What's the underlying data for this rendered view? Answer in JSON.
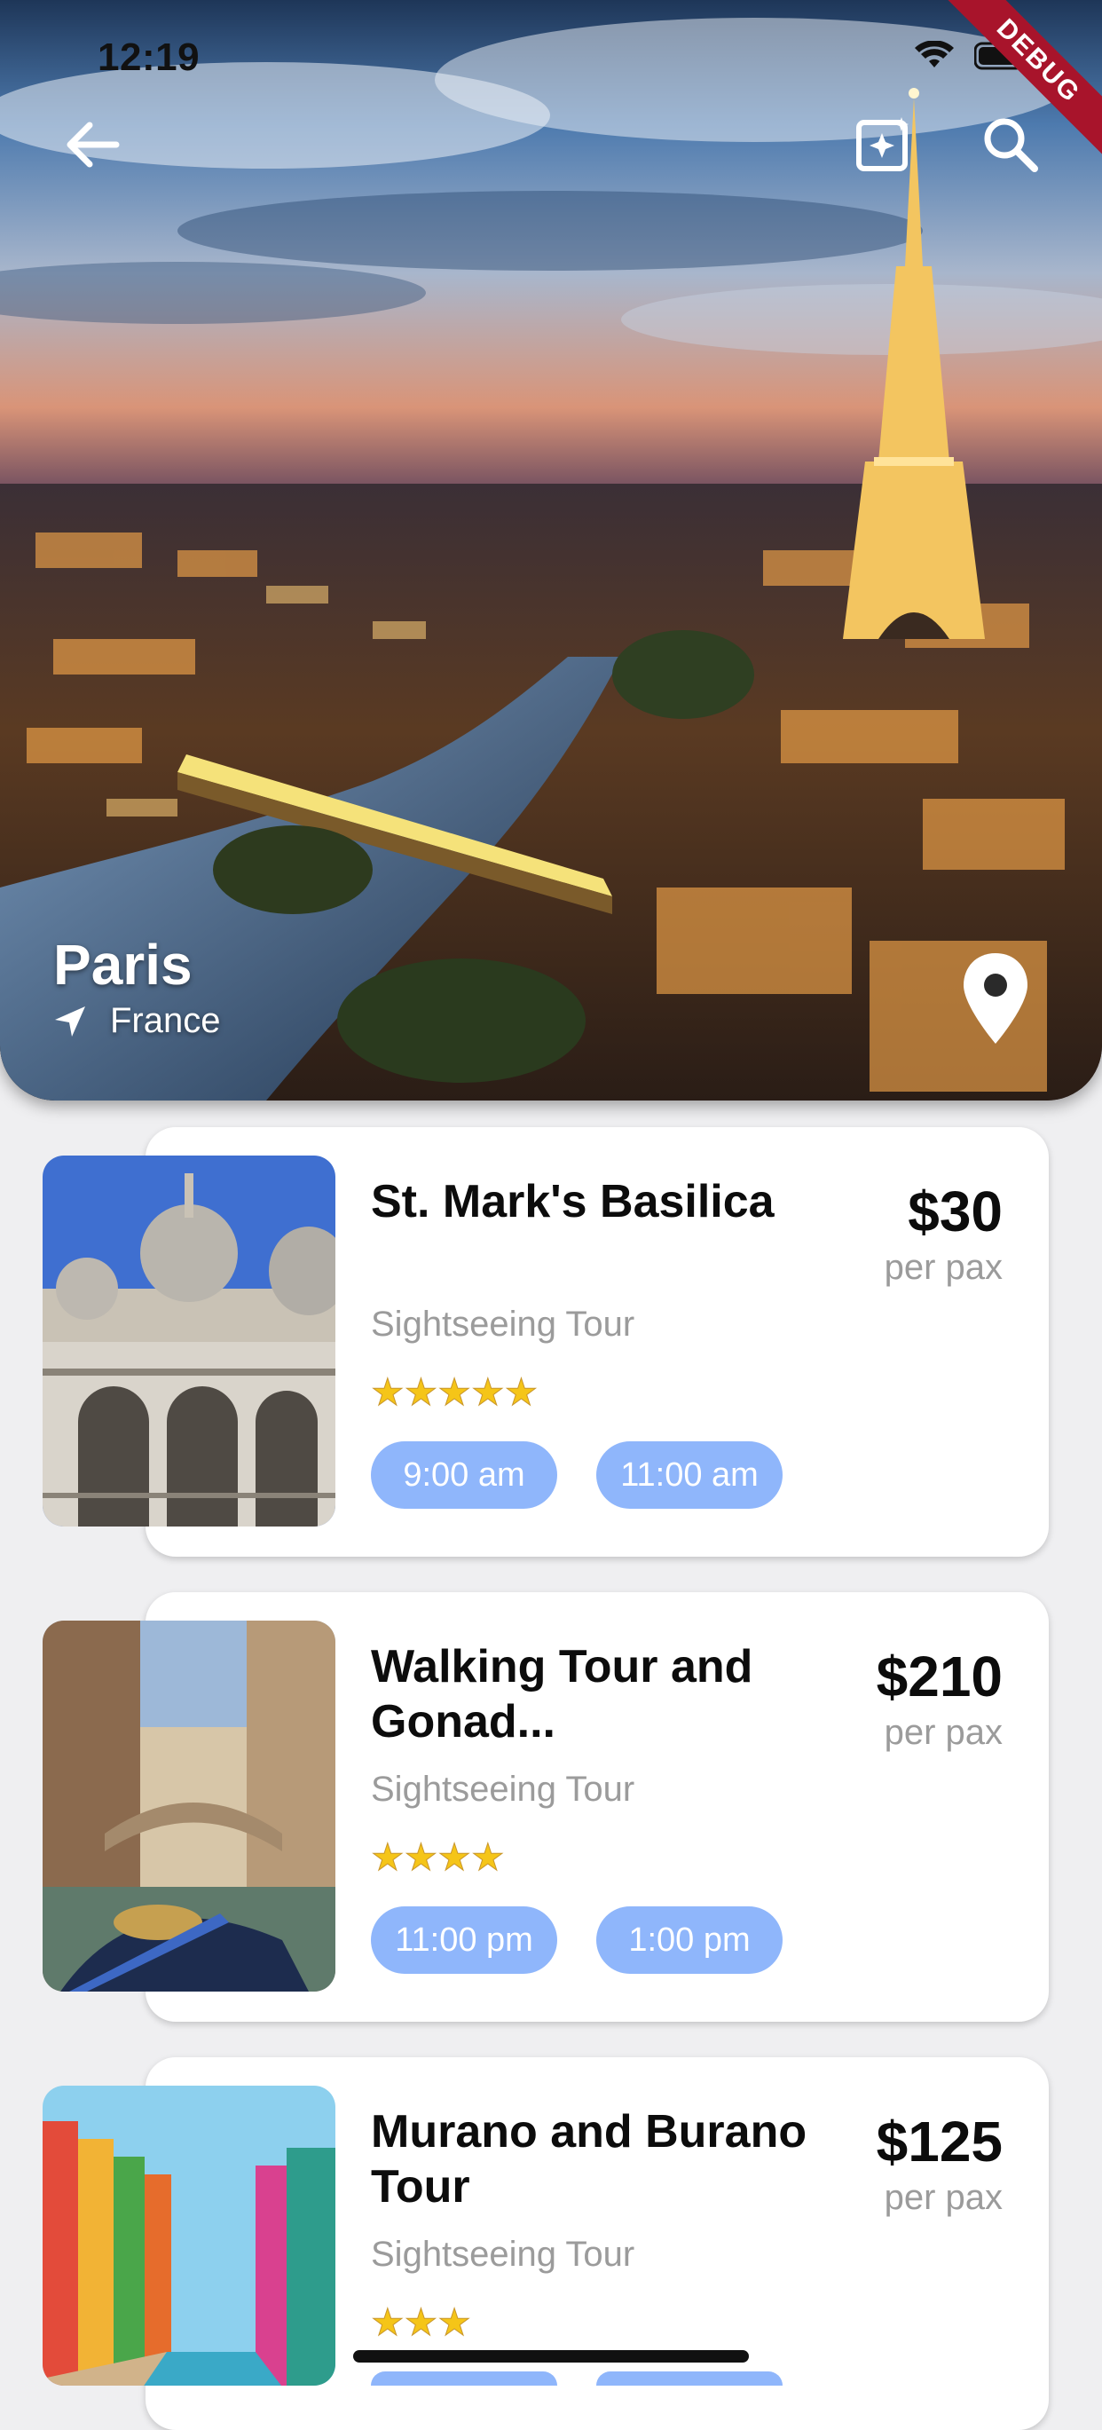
{
  "status_bar": {
    "time": "12:19",
    "debug_label": "DEBUG"
  },
  "icons": {
    "back": "arrow-left-icon",
    "magic": "sparkle-icon",
    "search": "search-icon",
    "location": "location-arrow-icon",
    "pin": "map-pin-icon",
    "wifi": "wifi-icon",
    "battery": "battery-icon"
  },
  "destination": {
    "city": "Paris",
    "country": "France"
  },
  "activities": [
    {
      "name": "St. Mark's Basilica",
      "type": "Sightseeing Tour",
      "rating": 5,
      "stars": "★★★★★",
      "price": "$30",
      "per": "per pax",
      "times": [
        "9:00 am",
        "11:00 am"
      ]
    },
    {
      "name": "Walking Tour and Gonad...",
      "type": "Sightseeing Tour",
      "rating": 4,
      "stars": "★★★★",
      "price": "$210",
      "per": "per pax",
      "times": [
        "11:00 pm",
        "1:00 pm"
      ]
    },
    {
      "name": "Murano and Burano Tour",
      "type": "Sightseeing Tour",
      "rating": 3,
      "stars": "★★★",
      "price": "$125",
      "per": "per pax",
      "times": [
        "",
        ""
      ]
    }
  ],
  "colors": {
    "chip": "#8fb6fb",
    "star": "#f5c518",
    "background": "#efeff1"
  }
}
